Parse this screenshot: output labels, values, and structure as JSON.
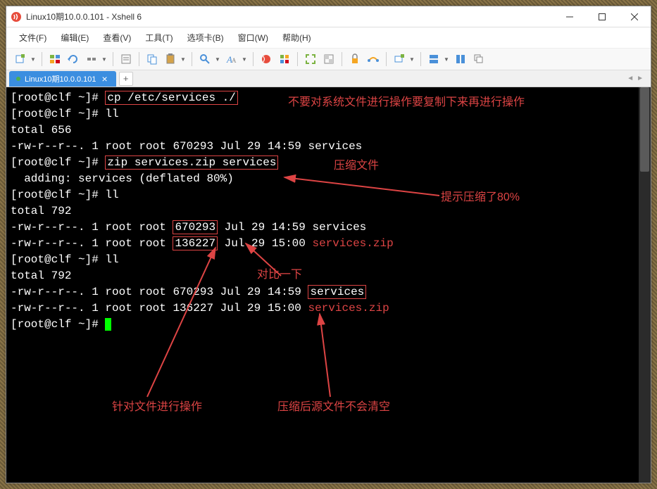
{
  "window": {
    "title": "Linux10期10.0.0.101 - Xshell 6"
  },
  "menubar": {
    "file": "文件(F)",
    "edit": "编辑(E)",
    "view": "查看(V)",
    "tools": "工具(T)",
    "tab": "选项卡(B)",
    "window": "窗口(W)",
    "help": "帮助(H)"
  },
  "tab": {
    "label": "Linux10期10.0.0.101"
  },
  "term": {
    "prompt": "[root@clf ~]# ",
    "cmd_cp": "cp /etc/services ./",
    "cmd_ll1": "ll",
    "total656": "total 656",
    "ls1": "-rw-r--r--. 1 root root 670293 Jul 29 14:59 services",
    "cmd_zip": "zip services.zip services",
    "adding": "  adding: services (deflated 80%)",
    "cmd_ll2": "ll",
    "total792a": "total 792",
    "ls2a_pre": "-rw-r--r--. 1 root root ",
    "ls2a_size": "670293",
    "ls2a_post": " Jul 29 14:59 services",
    "ls2b_pre": "-rw-r--r--. 1 root root ",
    "ls2b_size": "136227",
    "ls2b_post": " Jul 29 15:00 ",
    "ls2b_file": "services.zip",
    "cmd_ll3": "ll",
    "total792b": "total 792",
    "ls3a": "-rw-r--r--. 1 root root 670293 Jul 29 14:59 ",
    "ls3a_file": "services",
    "ls3b": "-rw-r--r--. 1 root root 136227 Jul 29 15:00 ",
    "ls3b_file": "services.zip"
  },
  "annotations": {
    "a1": "不要对系统文件进行操作要复制下来再进行操作",
    "a2": "压缩文件",
    "a3": "提示压缩了80%",
    "a4": "对比一下",
    "a5": "针对文件进行操作",
    "a6": "压缩后源文件不会清空"
  }
}
